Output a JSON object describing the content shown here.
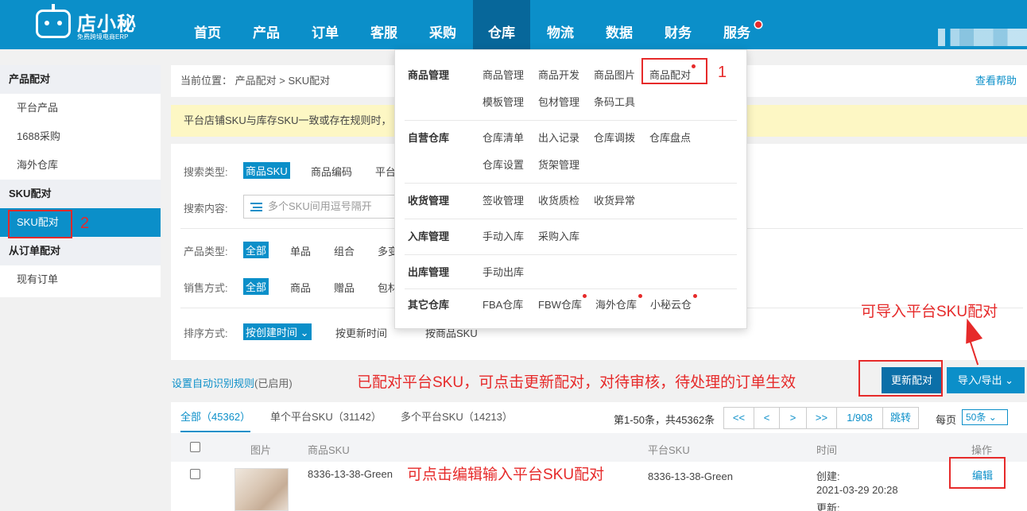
{
  "brand": {
    "name": "店小秘",
    "slogan": "免费跨境电商ERP"
  },
  "nav": {
    "items": [
      "首页",
      "产品",
      "订单",
      "客服",
      "采购",
      "仓库",
      "物流",
      "数据",
      "财务",
      "服务"
    ],
    "active": "仓库"
  },
  "sidebar": {
    "groups": [
      {
        "title": "产品配对",
        "items": [
          "平台产品",
          "1688采购",
          "海外仓库"
        ]
      },
      {
        "title": "SKU配对",
        "items": [
          "SKU配对"
        ]
      },
      {
        "title": "从订单配对",
        "items": [
          "现有订单"
        ]
      }
    ],
    "active": "SKU配对"
  },
  "breadcrumb": {
    "prefix": "当前位置：",
    "path": "产品配对 > SKU配对",
    "help": "查看帮助"
  },
  "notice": "平台店铺SKU与库存SKU一致或存在规则时，",
  "filter": {
    "search_type_label": "搜索类型:",
    "search_types": [
      "商品SKU",
      "商品编码",
      "平台"
    ],
    "search_content_label": "搜索内容:",
    "search_placeholder": "多个SKU间用逗号隔开",
    "product_type_label": "产品类型:",
    "product_types": [
      "全部",
      "单品",
      "组合",
      "多变"
    ],
    "sale_mode_label": "销售方式:",
    "sale_modes": [
      "全部",
      "商品",
      "赠品",
      "包材"
    ],
    "sort_label": "排序方式:",
    "sorts": [
      "按创建时间",
      "按更新时间",
      "按商品SKU"
    ]
  },
  "dropdown": {
    "sections": [
      {
        "title": "商品管理",
        "links": [
          "商品管理",
          "商品开发",
          "商品图片",
          "商品配对",
          "模板管理",
          "包材管理",
          "条码工具"
        ]
      },
      {
        "title": "自营仓库",
        "links": [
          "仓库清单",
          "出入记录",
          "仓库调拨",
          "仓库盘点",
          "仓库设置",
          "货架管理"
        ]
      },
      {
        "title": "收货管理",
        "links": [
          "签收管理",
          "收货质检",
          "收货异常"
        ]
      },
      {
        "title": "入库管理",
        "links": [
          "手动入库",
          "采购入库"
        ]
      },
      {
        "title": "出库管理",
        "links": [
          "手动出库"
        ]
      },
      {
        "title": "其它仓库",
        "links": [
          "FBA仓库",
          "FBW仓库",
          "海外仓库",
          "小秘云仓"
        ]
      }
    ]
  },
  "actions": {
    "auto_rule": "设置自动识别规则",
    "auto_rule_status": "(已启用)",
    "update_pair": "更新配对",
    "import_export": "导入/导出"
  },
  "tabs": [
    {
      "label": "全部（45362）"
    },
    {
      "label": "单个平台SKU（31142）"
    },
    {
      "label": "多个平台SKU（14213）"
    }
  ],
  "pagination": {
    "summary": "第1-50条，共45362条",
    "first": "<<",
    "prev": "<",
    "next": ">",
    "last": ">>",
    "current": "1/908",
    "jump": "跳转",
    "per_page_label": "每页",
    "per_page": "50条"
  },
  "table": {
    "columns": [
      "图片",
      "商品SKU",
      "平台SKU",
      "时间",
      "操作"
    ],
    "rows": [
      {
        "sku": "8336-13-38-Green",
        "platform_sku": "8336-13-38-Green",
        "created_label": "创建:",
        "created": "2021-03-29 20:28",
        "updated_label": "更新:",
        "action": "编辑"
      }
    ]
  },
  "annotations": {
    "step1": "1",
    "step2": "2",
    "import_note": "可导入平台SKU配对",
    "update_note": "已配对平台SKU，可点击更新配对，对待审核，待处理的订单生效",
    "edit_note": "可点击编辑输入平台SKU配对"
  },
  "colors": {
    "primary": "#0b8fc9",
    "annotation": "#e62a2a",
    "notice_bg": "#fdf7c4"
  }
}
